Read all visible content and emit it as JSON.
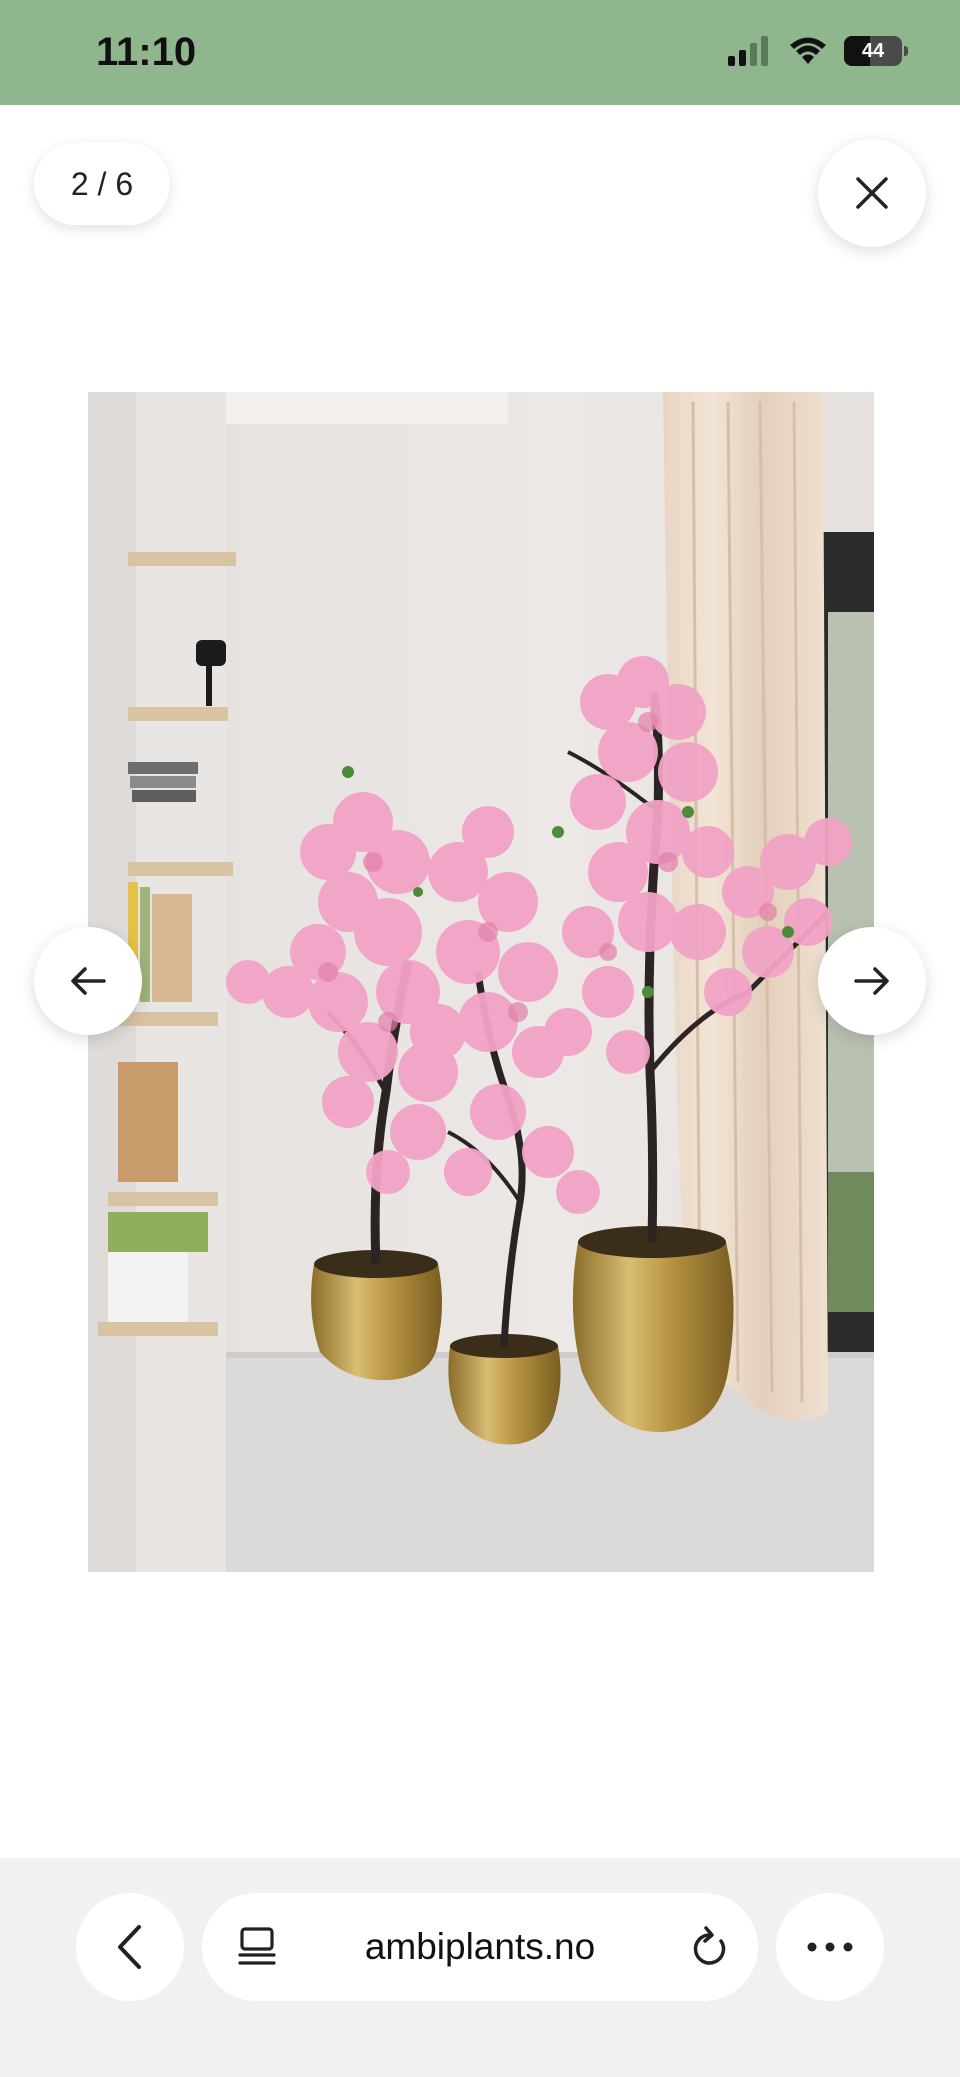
{
  "status_bar": {
    "time": "11:10",
    "battery_level": "44",
    "background_color": "#8fb68d",
    "icons": [
      "cellular-signal-icon",
      "wifi-icon",
      "battery-icon"
    ]
  },
  "gallery": {
    "counter": "2 / 6",
    "image_description_colors": {
      "blossom": "#f2a3c6",
      "pot": "#b89442",
      "wall": "#ebe6e3"
    },
    "icons": [
      "close-icon",
      "arrow-left-icon",
      "arrow-right-icon"
    ]
  },
  "browser": {
    "url": "ambiplants.no",
    "icons": [
      "chevron-left-icon",
      "reader-mode-icon",
      "reload-icon",
      "more-icon"
    ]
  }
}
